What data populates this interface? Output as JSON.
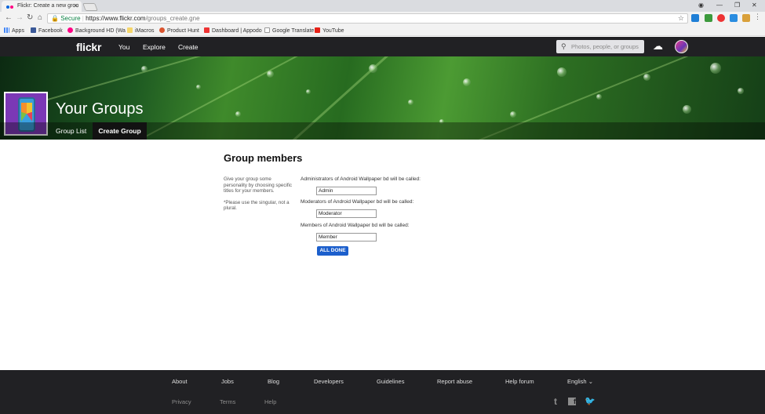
{
  "browser": {
    "tab_title": "Flickr: Create a new grou",
    "secure_label": "Secure",
    "url_host": "https://www.flickr.com",
    "url_path": "/groups_create.gne",
    "bookmarks": [
      "Apps",
      "Facebook",
      "Background HD (Wa",
      "iMacros",
      "Product Hunt",
      "Dashboard | Appodo",
      "Google Translate",
      "YouTube"
    ]
  },
  "nav": {
    "logo": "flickr",
    "links": [
      "You",
      "Explore",
      "Create"
    ],
    "search_placeholder": "Photos, people, or groups"
  },
  "header": {
    "title": "Your Groups",
    "tabs": [
      "Group List",
      "Create Group"
    ],
    "active_tab": "Create Group"
  },
  "main": {
    "heading": "Group members",
    "help_text": "Give your group some personality by choosing specific titles for your members.",
    "help_note": "*Please use the singular, not a plural.",
    "fields": [
      {
        "label": "Administrators of Android Wallpaper bd will be called:",
        "value": "Admin"
      },
      {
        "label": "Moderators of Android Wallpaper bd will be called:",
        "value": "Moderator"
      },
      {
        "label": "Members of Android Wallpaper bd will be called:",
        "value": "Member"
      }
    ],
    "submit_label": "ALL DONE"
  },
  "footer": {
    "links": [
      "About",
      "Jobs",
      "Blog",
      "Developers",
      "Guidelines",
      "Report abuse",
      "Help forum"
    ],
    "language": "English",
    "secondary": [
      "Privacy",
      "Terms",
      "Help"
    ],
    "social": [
      "tumblr-icon",
      "facebook-icon",
      "twitter-icon"
    ]
  }
}
